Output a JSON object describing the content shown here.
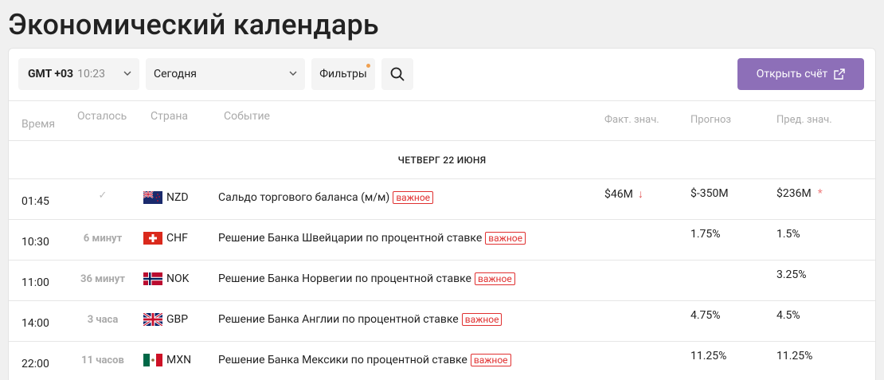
{
  "title": "Экономический календарь",
  "toolbar": {
    "timezone_label": "GMT +03",
    "timezone_time": "10:23",
    "day_value": "Сегодня",
    "filters_label": "Фильтры",
    "open_account_label": "Открыть счёт"
  },
  "columns": {
    "time": "Время",
    "remaining": "Осталось",
    "country": "Страна",
    "event": "Событие",
    "actual": "Факт. знач.",
    "forecast": "Прогноз",
    "previous": "Пред. знач."
  },
  "date_group": "ЧЕТВЕРГ 22 ИЮНЯ",
  "rows": [
    {
      "time": "01:45",
      "remaining": "✓",
      "currency": "NZD",
      "flag": "nz",
      "event": "Сальдо торгового баланса (м/м)",
      "badge": "важное",
      "actual": "$46M",
      "forecast": "$-350M",
      "previous": "$236M"
    },
    {
      "time": "10:30",
      "remaining": "6 минут",
      "currency": "CHF",
      "flag": "ch",
      "event": "Решение Банка Швейцарии по процентной ставке",
      "badge": "важное",
      "actual": "",
      "forecast": "1.75%",
      "previous": "1.5%"
    },
    {
      "time": "11:00",
      "remaining": "36 минут",
      "currency": "NOK",
      "flag": "no",
      "event": "Решение Банка Норвегии по процентной ставке",
      "badge": "важное",
      "actual": "",
      "forecast": "",
      "previous": "3.25%"
    },
    {
      "time": "14:00",
      "remaining": "3 часа",
      "currency": "GBP",
      "flag": "gb",
      "event": "Решение Банка Англии по процентной ставке",
      "badge": "важное",
      "actual": "",
      "forecast": "4.75%",
      "previous": "4.5%"
    },
    {
      "time": "22:00",
      "remaining": "11 часов",
      "currency": "MXN",
      "flag": "mx",
      "event": "Решение Банка Мексики по процентной ставке",
      "badge": "важное",
      "actual": "",
      "forecast": "11.25%",
      "previous": "11.25%"
    }
  ],
  "colors": {
    "accent": "#8d6fb8",
    "important": "#e03030",
    "down_arrow": "#e05050"
  }
}
